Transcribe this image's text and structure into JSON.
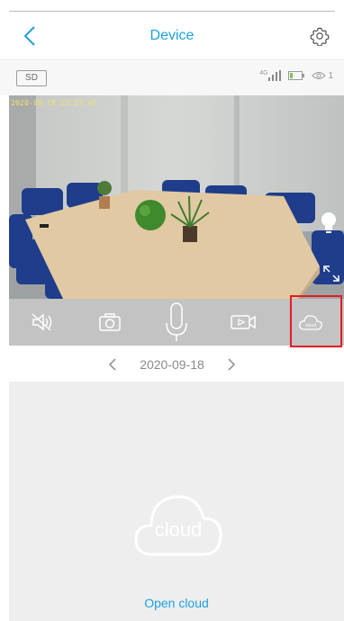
{
  "header": {
    "title": "Device",
    "back_icon": "chevron-left-icon",
    "settings_icon": "gear-icon"
  },
  "status": {
    "sd_label": "SD",
    "network_label": "4G",
    "viewer_count": "1"
  },
  "video": {
    "timestamp": "2020-09-18 13:57:42"
  },
  "toolbar": {
    "items": [
      "mute-icon",
      "camera-icon",
      "microphone-icon",
      "video-record-icon",
      "cloud-icon"
    ],
    "cloud_label": "cloud"
  },
  "date_nav": {
    "date": "2020-09-18"
  },
  "cloud_panel": {
    "cloud_label": "cloud",
    "open_label": "Open cloud"
  },
  "colors": {
    "accent": "#1da1e0",
    "highlight": "#e51c23"
  }
}
